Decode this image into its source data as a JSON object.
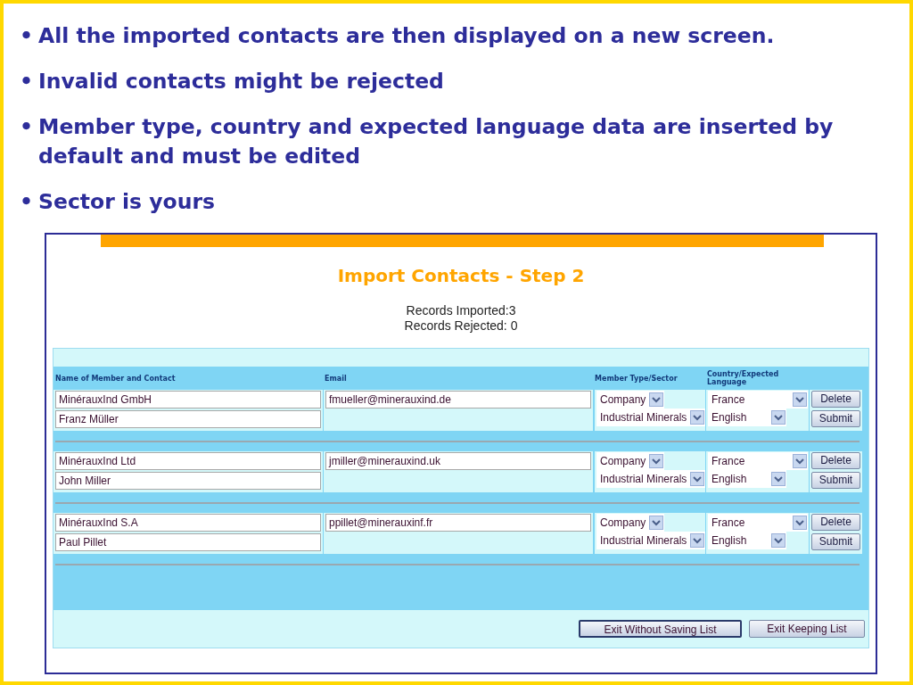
{
  "bullets": [
    {
      "marker": "•",
      "text": "All the imported contacts are then displayed on a new screen."
    },
    {
      "marker": "•",
      "text": "Invalid contacts might be rejected"
    },
    {
      "marker": "•",
      "text": "Member type, country and expected language data are inserted by default and must be edited"
    },
    {
      "marker": "•",
      "text": "Sector is yours"
    }
  ],
  "screenshot": {
    "title": "Import Contacts - Step 2",
    "summary": [
      "Records Imported:3",
      "Records Rejected: 0"
    ],
    "columns": [
      "Name of Member and Contact",
      "Email",
      "Member Type/Sector",
      "Country/Expected Language"
    ],
    "rows": [
      {
        "member": "MinérauxInd GmbH",
        "contact": "Franz Müller",
        "email": "fmueller@minerauxind.de",
        "member_type": "Company",
        "sector": "Industrial Minerals",
        "country": "France",
        "language": "English",
        "actions": [
          "Delete",
          "Submit"
        ]
      },
      {
        "member": "MinérauxInd Ltd",
        "contact": "John Miller",
        "email": "jmiller@minerauxind.uk",
        "member_type": "Company",
        "sector": "Industrial Minerals",
        "country": "France",
        "language": "English",
        "actions": [
          "Delete",
          "Submit"
        ]
      },
      {
        "member": "MinérauxInd S.A",
        "contact": "Paul Pillet",
        "email": "ppillet@minerauxinf.fr",
        "member_type": "Company",
        "sector": "Industrial Minerals",
        "country": "France",
        "language": "English",
        "actions": [
          "Delete",
          "Submit"
        ]
      }
    ],
    "footer_buttons": [
      {
        "label": "Exit Without Saving List",
        "focused": true
      },
      {
        "label": "Exit Keeping List",
        "focused": false
      }
    ]
  }
}
